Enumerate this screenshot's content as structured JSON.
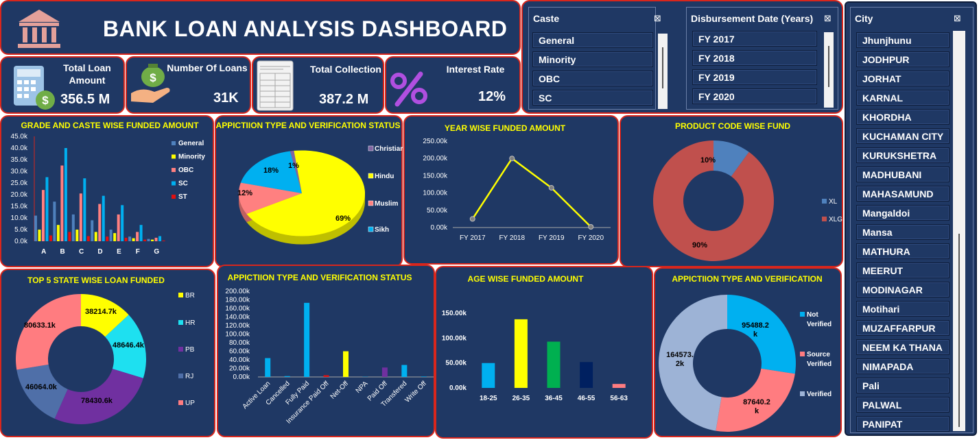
{
  "header": {
    "title": "BANK LOAN ANALYSIS DASHBOARD",
    "icon": "bank-icon"
  },
  "kpis": [
    {
      "label": "Total Loan Amount",
      "value": "356.5  M",
      "icon": "calculator-icon"
    },
    {
      "label": "Number Of  Loans",
      "value": "31K",
      "icon": "money-bag-icon"
    },
    {
      "label": "Total Collection",
      "value": "387.2  M",
      "icon": "document-icon"
    },
    {
      "label": "Interest  Rate",
      "value": "12%",
      "icon": "percent-icon"
    }
  ],
  "slicers": {
    "caste": {
      "title": "Caste",
      "items": [
        "General",
        "Minority",
        "OBC",
        "SC"
      ]
    },
    "years": {
      "title": "Disbursement Date (Years)",
      "items": [
        "FY 2017",
        "FY 2018",
        "FY 2019",
        "FY 2020"
      ]
    },
    "city": {
      "title": "City",
      "items": [
        "Jhunjhunu",
        "JODHPUR",
        "JORHAT",
        "KARNAL",
        "KHORDHA",
        "KUCHAMAN CITY",
        "KURUKSHETRA",
        "MADHUBANI",
        "MAHASAMUND",
        "Mangaldoi",
        "Mansa",
        "MATHURA",
        "MEERUT",
        "MODINAGAR",
        "Motihari",
        "MUZAFFARPUR",
        "NEEM KA THANA",
        "NIMAPADA",
        "Pali",
        "PALWAL",
        "PANIPAT"
      ]
    }
  },
  "colors": {
    "panel": "#1f3864",
    "border": "#d9261c",
    "title": "#ffff00"
  },
  "chart_data": [
    {
      "type": "bar",
      "title": "GRADE AND CASTE WISE FUNDED AMOUNT",
      "categories": [
        "A",
        "B",
        "C",
        "D",
        "E",
        "F",
        "G"
      ],
      "y_ticks": [
        "0.0k",
        "5.0k",
        "10.0k",
        "15.0k",
        "20.0k",
        "25.0k",
        "30.0k",
        "35.0k",
        "40.0k",
        "45.0k"
      ],
      "ylim": [
        0,
        45
      ],
      "series": [
        {
          "name": "General",
          "color": "#4f81bd",
          "values": [
            11,
            17,
            11.5,
            9,
            5,
            2,
            1
          ]
        },
        {
          "name": "Minority",
          "color": "#ffff00",
          "values": [
            5,
            7,
            5,
            4,
            3.5,
            1.3,
            0.7
          ]
        },
        {
          "name": "OBC",
          "color": "#ff8080",
          "values": [
            22,
            32.5,
            20.5,
            16,
            11.5,
            4,
            1.5
          ]
        },
        {
          "name": "SC",
          "color": "#00b0f0",
          "values": [
            27.5,
            40,
            27,
            19.5,
            15.5,
            7,
            2.2
          ]
        },
        {
          "name": "ST",
          "color": "#e01010",
          "values": [
            2.5,
            4,
            2.2,
            2,
            1.5,
            0.7,
            0.3
          ]
        }
      ]
    },
    {
      "type": "pie",
      "title": "APPICTIION TYPE AND VERIFICATION STATUS",
      "labels": [
        "Christian",
        "Hindu",
        "Muslim",
        "Sikh"
      ],
      "values": [
        1,
        69,
        12,
        18
      ],
      "display": [
        "1%",
        "69%",
        "12%",
        "18%"
      ],
      "colors": [
        "#8064a2",
        "#ffff00",
        "#ff8080",
        "#00b0f0"
      ]
    },
    {
      "type": "line",
      "title": "YEAR WISE FUNDED AMOUNT",
      "x": [
        "FY 2017",
        "FY 2018",
        "FY 2019",
        "FY 2020"
      ],
      "values": [
        25,
        200,
        115,
        2
      ],
      "y_ticks": [
        "0.00k",
        "50.00k",
        "100.00k",
        "150.00k",
        "200.00k",
        "250.00k"
      ],
      "ylim": [
        0,
        250
      ]
    },
    {
      "type": "pie",
      "title": "PRODUCT CODE WISE FUND",
      "labels": [
        "XL",
        "XLG"
      ],
      "values": [
        10,
        90
      ],
      "display": [
        "10%",
        "90%"
      ],
      "colors": [
        "#4f81bd",
        "#c0504d"
      ]
    },
    {
      "type": "pie",
      "title": "TOP 5  STATE WISE LOAN FUNDED",
      "labels": [
        "BR",
        "HR",
        "PB",
        "RJ",
        "UP"
      ],
      "values": [
        38214.7,
        48646.4,
        78430.6,
        46064.0,
        80633.1
      ],
      "display": [
        "38214.7k",
        "48646.4k",
        "78430.6k",
        "46064.0k",
        "80633.1k"
      ],
      "colors": [
        "#ffff00",
        "#1ee0f0",
        "#7030a0",
        "#4f6fa8",
        "#ff7c80"
      ]
    },
    {
      "type": "bar",
      "title": "APPICTIION TYPE AND VERIFICATION STATUS",
      "categories": [
        "Active Loan",
        "Cancelled",
        "Fully Paid",
        "Insurance Paid Off",
        "Net-Off",
        "NPA",
        "Paid Off",
        "Transfered",
        "Write Off"
      ],
      "values": [
        44,
        2,
        173,
        4,
        60,
        0.5,
        22,
        28,
        1
      ],
      "colors": [
        "#00b0f0",
        "#00b0f0",
        "#00b0f0",
        "#e01010",
        "#ffff00",
        "#00b0f0",
        "#7030a0",
        "#00b0f0",
        "#00b0f0"
      ],
      "y_ticks": [
        "0.00k",
        "20.00k",
        "40.00k",
        "60.00k",
        "80.00k",
        "100.00k",
        "120.00k",
        "140.00k",
        "160.00k",
        "180.00k",
        "200.00k"
      ],
      "ylim": [
        0,
        200
      ]
    },
    {
      "type": "bar",
      "title": "AGE WISE FUNDED AMOUNT",
      "categories": [
        "18-25",
        "26-35",
        "36-45",
        "46-55",
        "56-63"
      ],
      "values": [
        50,
        138,
        93,
        52,
        8
      ],
      "colors": [
        "#00b0f0",
        "#ffff00",
        "#00b050",
        "#002060",
        "#ff7c80"
      ],
      "y_ticks": [
        "0.00k",
        "50.00k",
        "100.00k",
        "150.00k"
      ],
      "ylim": [
        0,
        175
      ]
    },
    {
      "type": "pie",
      "title": "APPICTIION TYPE AND VERIFICATION",
      "labels": [
        "Not Verified",
        "Source Verified",
        "Verified"
      ],
      "values": [
        95488.2,
        87640.2,
        164573.2
      ],
      "display": [
        "95488.2 k",
        "87640.2 k",
        "164573. 2k"
      ],
      "colors": [
        "#00b0f0",
        "#ff7c80",
        "#9db3d6"
      ]
    }
  ]
}
